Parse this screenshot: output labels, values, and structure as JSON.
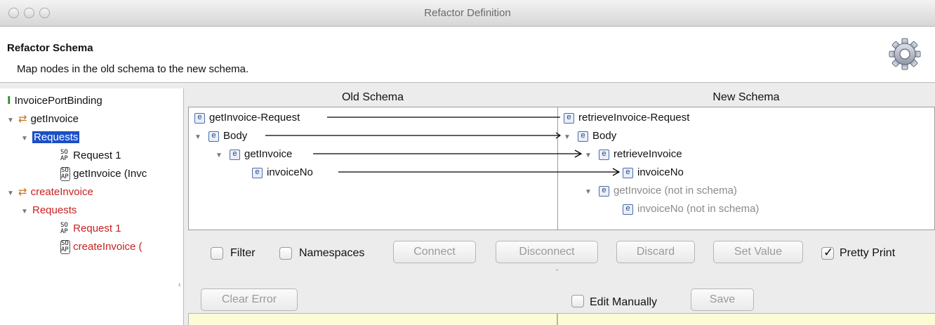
{
  "window": {
    "title": "Refactor Definition"
  },
  "header": {
    "title": "Refactor Schema",
    "description": "Map nodes in the old schema to the new schema."
  },
  "tree": {
    "binding": "InvoicePortBinding",
    "op1": "getInvoice",
    "op1_requests": "Requests",
    "op1_request1": "Request 1",
    "op1_request2": "getInvoice (Invc",
    "op2": "createInvoice",
    "op2_requests": "Requests",
    "op2_request1": "Request 1",
    "op2_request2": "createInvoice ("
  },
  "old_schema": {
    "heading": "Old Schema",
    "nodes": [
      "getInvoice-Request",
      "Body",
      "getInvoice",
      "invoiceNo"
    ]
  },
  "new_schema": {
    "heading": "New Schema",
    "nodes": [
      "retrieveInvoice-Request",
      "Body",
      "retrieveInvoice",
      "invoiceNo",
      "getInvoice (not in schema)",
      "invoiceNo (not in schema)"
    ]
  },
  "icons": {
    "element": "e",
    "settings": "gear-icon",
    "soap_request": "soap-request-icon"
  },
  "toolbar": {
    "filter": "Filter",
    "namespaces": "Namespaces",
    "connect": "Connect",
    "disconnect": "Disconnect",
    "discard": "Discard",
    "set_value": "Set Value",
    "pretty_print": "Pretty Print",
    "pretty_print_checked": true,
    "clear_error": "Clear Error",
    "edit_manually": "Edit Manually",
    "save": "Save"
  },
  "colors": {
    "selection": "#1a4fc6",
    "error_red": "#c82020",
    "editor_bg": "#fbfbd6"
  }
}
